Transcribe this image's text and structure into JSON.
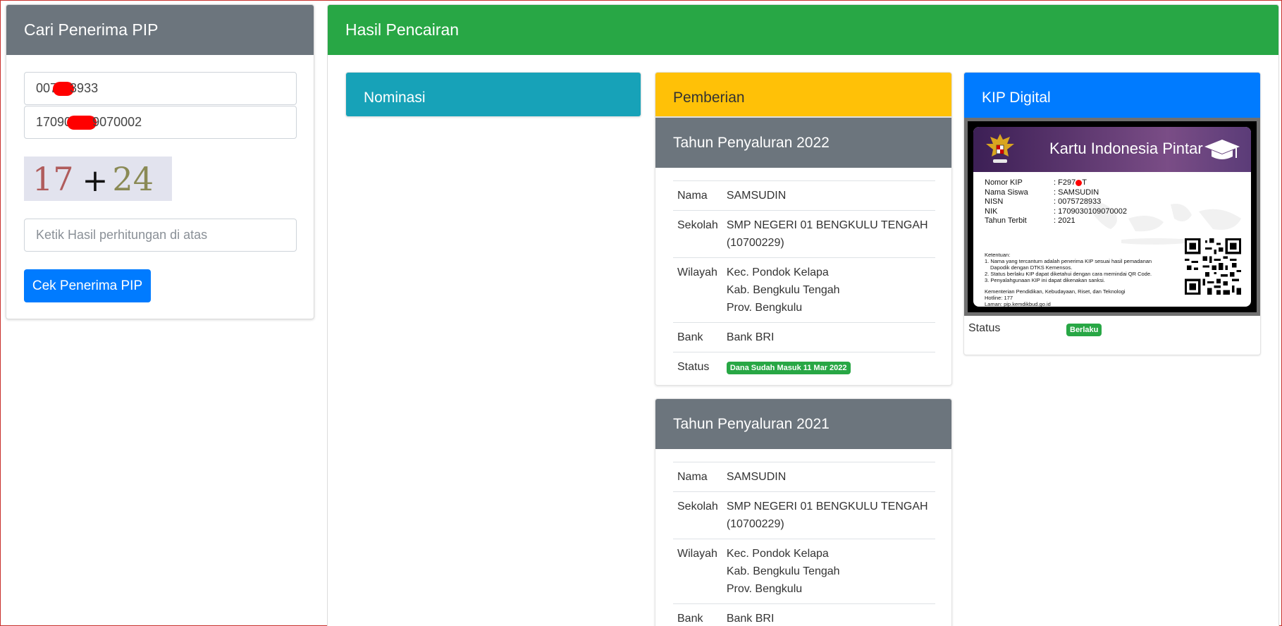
{
  "search": {
    "title": "Cari Penerima PIP",
    "nisn_prefix": "007",
    "nisn_suffix": "3933",
    "nik_prefix": "17090",
    "nik_suffix": "9070002",
    "captcha_a": "17",
    "captcha_op": "+",
    "captcha_b": "24",
    "answer_placeholder": "Ketik Hasil perhitungan di atas",
    "button_label": "Cek Penerima PIP"
  },
  "result": {
    "title": "Hasil Pencairan",
    "nominasi_title": "Nominasi",
    "pemberian_title": "Pemberian",
    "years": [
      {
        "title": "Tahun Penyaluran 2022",
        "nama_label": "Nama",
        "nama": "SAMSUDIN",
        "sekolah_label": "Sekolah",
        "sekolah_1": "SMP NEGERI 01 BENGKULU TENGAH",
        "sekolah_2": "(10700229)",
        "wilayah_label": "Wilayah",
        "wilayah_1": "Kec. Pondok Kelapa",
        "wilayah_2": "Kab. Bengkulu Tengah",
        "wilayah_3": "Prov. Bengkulu",
        "bank_label": "Bank",
        "bank": "Bank BRI",
        "status_label": "Status",
        "status": "Dana Sudah Masuk 11 Mar 2022"
      },
      {
        "title": "Tahun Penyaluran 2021",
        "nama_label": "Nama",
        "nama": "SAMSUDIN",
        "sekolah_label": "Sekolah",
        "sekolah_1": "SMP NEGERI 01 BENGKULU TENGAH",
        "sekolah_2": "(10700229)",
        "wilayah_label": "Wilayah",
        "wilayah_1": "Kec. Pondok Kelapa",
        "wilayah_2": "Kab. Bengkulu Tengah",
        "wilayah_3": "Prov. Bengkulu",
        "bank_label": "Bank",
        "bank": "Bank BRI"
      }
    ],
    "kip": {
      "title": "KIP Digital",
      "card_title": "Kartu Indonesia Pintar",
      "nomor_label": "Nomor KIP",
      "nomor_prefix": ": F297",
      "nomor_suffix": "T",
      "nama_label": "Nama Siswa",
      "nama": ": SAMSUDIN",
      "nisn_label": "NISN",
      "nisn": ": 0075728933",
      "nik_label": "NIK",
      "nik": ": 1709030109070002",
      "tahun_label": "Tahun Terbit",
      "tahun": ": 2021",
      "notes_title": "Ketentuan:",
      "note_1": "1. Nama yang tercantum adalah penerima KIP sesuai hasil pemadanan",
      "note_1b": "Dapodik dengan DTKS Kemensos.",
      "note_2": "2. Status berlaku KIP dapat diketahui dengan cara memindai QR Code.",
      "note_3": "3. Penyalahgunaan KIP ini dapat dikenakan sanksi.",
      "foot_1": "Kementerian Pendidikan, Kebudayaan, Riset, dan Teknologi",
      "foot_2": "Hotline: 177",
      "foot_3": "Laman: pip.kemdikbud.go.id",
      "status_label": "Status",
      "status": "Berlaku"
    }
  },
  "colors": {
    "gray": "#6c757d",
    "green": "#28a745",
    "teal": "#17a2b8",
    "yellow": "#ffc107",
    "blue": "#007bff"
  }
}
